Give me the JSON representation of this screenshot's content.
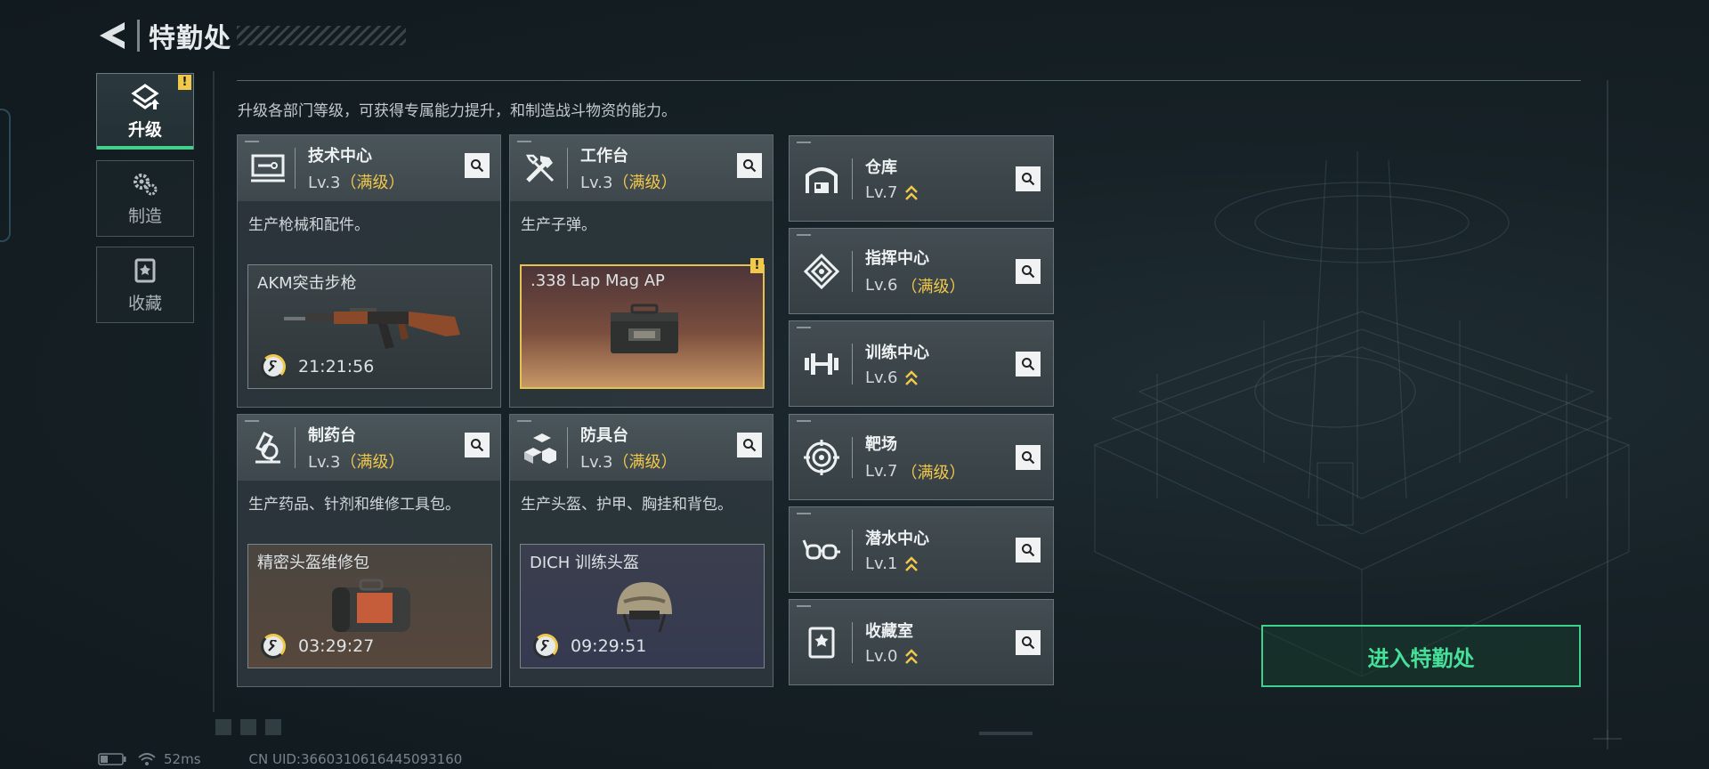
{
  "header": {
    "title": "特勤处"
  },
  "sidebar": {
    "tabs": [
      {
        "label": "升级",
        "icon": "upgrade-icon",
        "active": true,
        "warning": "!"
      },
      {
        "label": "制造",
        "icon": "gears-icon"
      },
      {
        "label": "收藏",
        "icon": "collection-icon"
      }
    ]
  },
  "description": "升级各部门等级，可获得专属能力提升，和制造战斗物资的能力。",
  "cards": [
    {
      "name": "技术中心",
      "level": "Lv.3",
      "max_label": "（满级）",
      "icon": "tech-center-icon",
      "desc": "生产枪械和配件。",
      "product": {
        "name": "AKM突击步枪",
        "timer": "21:21:56",
        "image": "rifle-image"
      }
    },
    {
      "name": "工作台",
      "level": "Lv.3",
      "max_label": "（满级）",
      "icon": "workbench-tools-icon",
      "desc": "生产子弹。",
      "product": {
        "name": ".338 Lap Mag AP",
        "timer": "",
        "warning": "!",
        "image": "ammo-box-image"
      }
    },
    {
      "name": "制药台",
      "level": "Lv.3",
      "max_label": "（满级）",
      "icon": "microscope-icon",
      "desc": "生产药品、针剂和维修工具包。",
      "product": {
        "name": "精密头盔维修包",
        "timer": "03:29:27",
        "image": "repair-bag-image"
      }
    },
    {
      "name": "防具台",
      "level": "Lv.3",
      "max_label": "（满级）",
      "icon": "armor-cubes-icon",
      "desc": "生产头盔、护甲、胸挂和背包。",
      "product": {
        "name": "DICH 训练头盔",
        "timer": "09:29:51",
        "image": "helmet-image"
      }
    }
  ],
  "facilities": [
    {
      "name": "仓库",
      "level": "Lv.7",
      "max_label": "",
      "upgradable": true,
      "icon": "warehouse-icon"
    },
    {
      "name": "指挥中心",
      "level": "Lv.6",
      "max_label": "（满级）",
      "upgradable": false,
      "icon": "command-center-icon"
    },
    {
      "name": "训练中心",
      "level": "Lv.6",
      "max_label": "",
      "upgradable": true,
      "icon": "dumbbell-icon"
    },
    {
      "name": "靶场",
      "level": "Lv.7",
      "max_label": "（满级）",
      "upgradable": false,
      "icon": "target-icon"
    },
    {
      "name": "潜水中心",
      "level": "Lv.1",
      "max_label": "",
      "upgradable": true,
      "icon": "diving-goggles-icon"
    },
    {
      "name": "收藏室",
      "level": "Lv.0",
      "max_label": "",
      "upgradable": true,
      "icon": "collection-room-icon"
    }
  ],
  "enter_button": "进入特勤处",
  "footer": {
    "ping": "52ms",
    "uid": "CN UID:3660310616445093160"
  },
  "colors": {
    "accent_green": "#3fd08e",
    "max_gold": "#f1c74a",
    "panel": "#2e383d"
  }
}
